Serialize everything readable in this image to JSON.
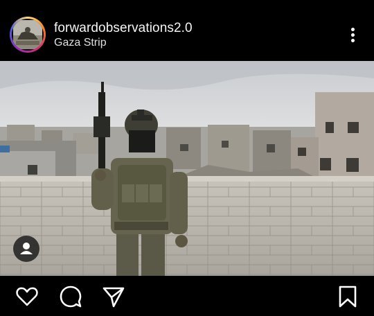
{
  "post": {
    "username": "forwardobservations2.0",
    "location": "Gaza Strip"
  },
  "icons": {
    "more": "more-options-icon",
    "user_tag": "user-tag-icon",
    "like": "heart-icon",
    "comment": "comment-icon",
    "share": "paper-plane-icon",
    "save": "bookmark-icon"
  }
}
